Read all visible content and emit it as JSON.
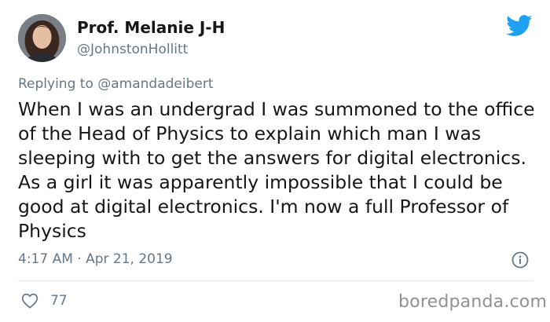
{
  "author": {
    "name": "Prof. Melanie J-H",
    "handle": "@JohnstonHollitt"
  },
  "reply": {
    "prefix": "Replying to ",
    "mention": "@amandadeibert"
  },
  "tweet": {
    "text": "When I was an undergrad I was summoned to the office of the Head of Physics to explain which man I was sleeping with to get the answers for digital electronics. As a girl it was apparently impossible that I could be good at digital electronics. I'm now a full Professor of Physics",
    "timestamp": "4:17 AM · Apr 21, 2019",
    "likes": "77"
  },
  "watermark": "boredpanda.com",
  "icons": {
    "brand": "twitter-bird-icon",
    "info": "info-icon",
    "like": "heart-icon"
  },
  "colors": {
    "twitter_blue": "#1da1f2",
    "secondary_text": "#657786",
    "primary_text": "#14171a"
  }
}
